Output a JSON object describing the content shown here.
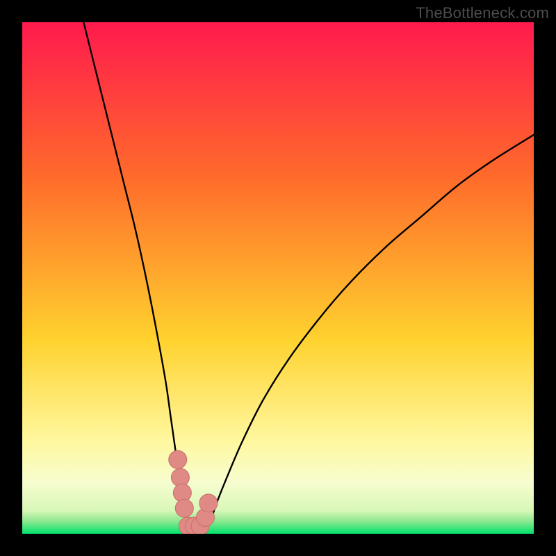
{
  "watermark": "TheBottleneck.com",
  "colors": {
    "gradient_top": "#ff1a4d",
    "gradient_mid1": "#ff6a2b",
    "gradient_mid2": "#ffd22e",
    "gradient_mid3": "#fff8a0",
    "gradient_mid4": "#f6fdcf",
    "gradient_bottom": "#00e36b",
    "curve": "#000000",
    "marker_fill": "#e08a86",
    "marker_stroke": "#c86e6a",
    "frame": "#000000"
  },
  "chart_data": {
    "type": "line",
    "title": "",
    "xlabel": "",
    "ylabel": "",
    "xlim": [
      0,
      100
    ],
    "ylim": [
      0,
      100
    ],
    "series": [
      {
        "name": "left-curve",
        "x": [
          12,
          14,
          16,
          18,
          20,
          22,
          24,
          26,
          28,
          29,
          30,
          30.8,
          31.4,
          31.8,
          32,
          32.2
        ],
        "y": [
          100,
          92,
          84,
          76,
          68,
          60,
          51,
          41,
          30,
          23,
          16,
          10,
          6,
          3,
          1.2,
          0
        ]
      },
      {
        "name": "right-curve",
        "x": [
          35.8,
          36.2,
          37,
          38,
          40,
          43,
          47,
          52,
          58,
          64,
          71,
          78,
          85,
          92,
          100
        ],
        "y": [
          0,
          1.2,
          3,
          6,
          11,
          18,
          26,
          34,
          42,
          49,
          56,
          62,
          68,
          73,
          78
        ]
      }
    ],
    "markers": [
      {
        "x": 30.4,
        "y": 14.5
      },
      {
        "x": 30.9,
        "y": 11.0
      },
      {
        "x": 31.3,
        "y": 8.0
      },
      {
        "x": 31.7,
        "y": 5.0
      },
      {
        "x": 32.4,
        "y": 1.5
      },
      {
        "x": 33.6,
        "y": 1.5
      },
      {
        "x": 34.8,
        "y": 1.5
      },
      {
        "x": 35.8,
        "y": 3.2
      },
      {
        "x": 36.4,
        "y": 6.0
      }
    ],
    "gradient_stops": [
      {
        "offset": 0.0,
        "color": "#ff1a4d"
      },
      {
        "offset": 0.3,
        "color": "#ff6a2b"
      },
      {
        "offset": 0.62,
        "color": "#ffd22e"
      },
      {
        "offset": 0.82,
        "color": "#fff8a0"
      },
      {
        "offset": 0.9,
        "color": "#f6fdcf"
      },
      {
        "offset": 0.955,
        "color": "#d8f7b7"
      },
      {
        "offset": 0.975,
        "color": "#8fe890"
      },
      {
        "offset": 1.0,
        "color": "#00e36b"
      }
    ]
  }
}
